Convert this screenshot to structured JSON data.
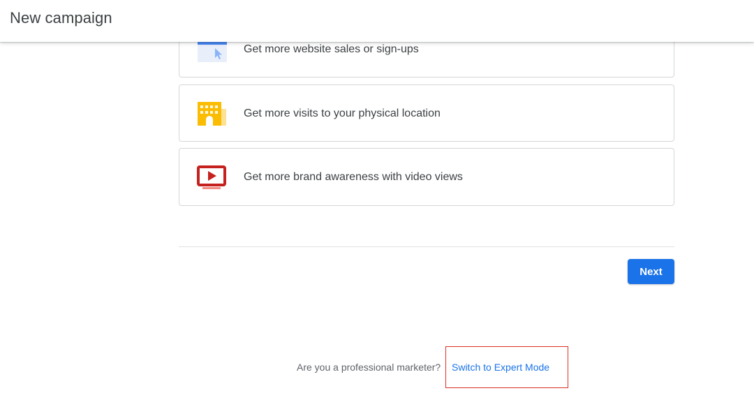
{
  "header": {
    "title": "New campaign"
  },
  "options": [
    {
      "label": "Get more website sales or sign-ups",
      "icon": "website-cursor-icon",
      "color": "#4285f4"
    },
    {
      "label": "Get more visits to your physical location",
      "icon": "storefront-icon",
      "color": "#fbbc04"
    },
    {
      "label": "Get more brand awareness with video views",
      "icon": "video-play-icon",
      "color": "#c5221f"
    }
  ],
  "actions": {
    "next_label": "Next"
  },
  "footer": {
    "prompt": "Are you a professional marketer?",
    "link": "Switch to Expert Mode"
  },
  "colors": {
    "primary": "#1a73e8",
    "highlight": "#d93025"
  }
}
